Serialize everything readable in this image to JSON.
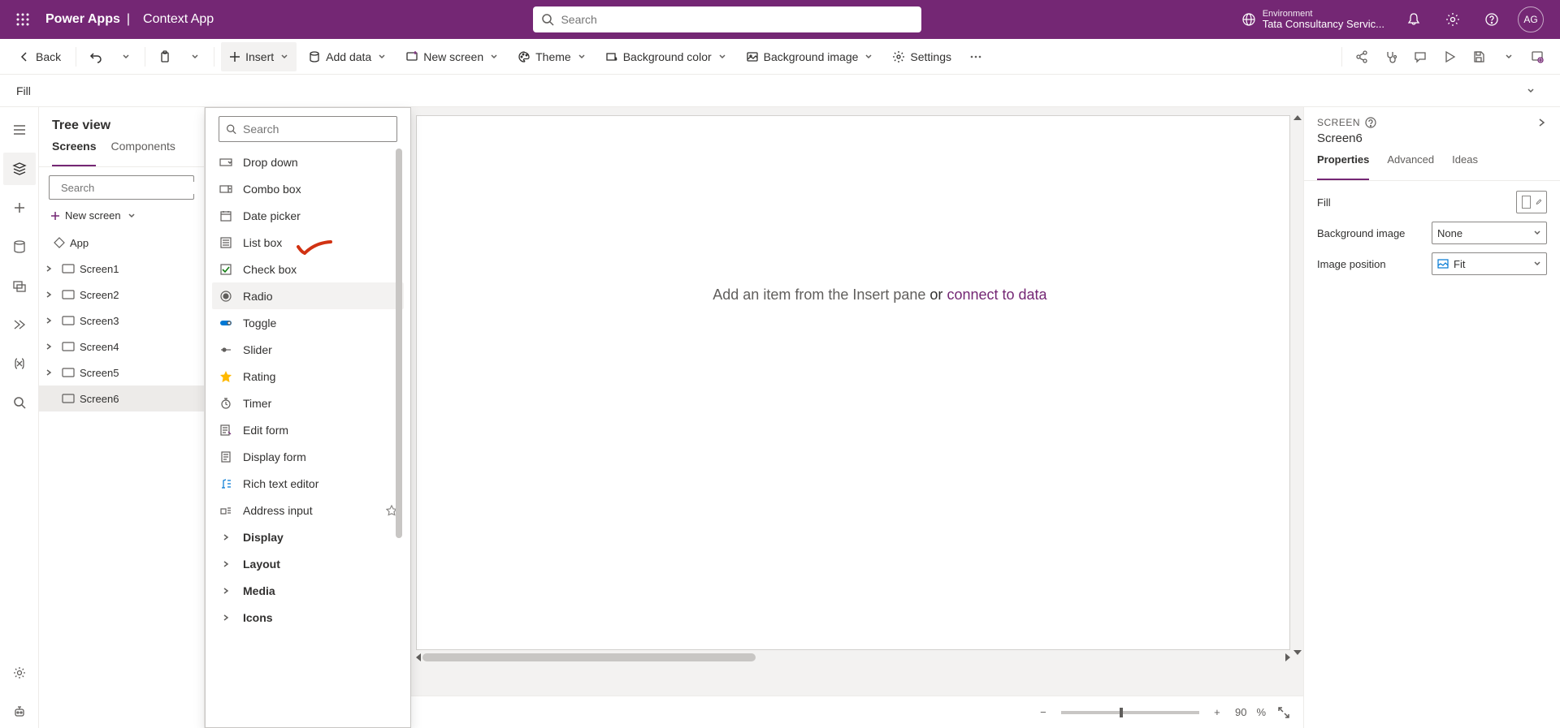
{
  "topbar": {
    "brand": "Power Apps",
    "sep": "|",
    "app_name": "Context App",
    "search_placeholder": "Search",
    "env_label": "Environment",
    "env_name": "Tata Consultancy Servic...",
    "avatar_initials": "AG"
  },
  "cmdbar": {
    "back": "Back",
    "insert": "Insert",
    "add_data": "Add data",
    "new_screen": "New screen",
    "theme": "Theme",
    "bg_color": "Background color",
    "bg_image": "Background image",
    "settings": "Settings"
  },
  "formula": {
    "property": "Fill"
  },
  "tree": {
    "title": "Tree view",
    "tab_screens": "Screens",
    "tab_components": "Components",
    "search_placeholder": "Search",
    "new_screen": "New screen",
    "app_label": "App",
    "screens": [
      "Screen1",
      "Screen2",
      "Screen3",
      "Screen4",
      "Screen5",
      "Screen6"
    ],
    "selected": "Screen6"
  },
  "insert_popup": {
    "search_placeholder": "Search",
    "items": [
      {
        "label": "Drop down",
        "icon": "dropdown"
      },
      {
        "label": "Combo box",
        "icon": "combobox"
      },
      {
        "label": "Date picker",
        "icon": "calendar"
      },
      {
        "label": "List box",
        "icon": "listbox"
      },
      {
        "label": "Check box",
        "icon": "checkbox"
      },
      {
        "label": "Radio",
        "icon": "radio",
        "highlight": true
      },
      {
        "label": "Toggle",
        "icon": "toggle"
      },
      {
        "label": "Slider",
        "icon": "slider"
      },
      {
        "label": "Rating",
        "icon": "star"
      },
      {
        "label": "Timer",
        "icon": "timer"
      },
      {
        "label": "Edit form",
        "icon": "editform"
      },
      {
        "label": "Display form",
        "icon": "displayform"
      },
      {
        "label": "Rich text editor",
        "icon": "richtext"
      },
      {
        "label": "Address input",
        "icon": "address",
        "premium": true
      }
    ],
    "categories": [
      "Display",
      "Layout",
      "Media",
      "Icons"
    ]
  },
  "canvas": {
    "empty_prefix": "Add an item from the Insert pane",
    "empty_or": " or ",
    "empty_link": "connect to data"
  },
  "zoom": {
    "value": "90",
    "pct": "%"
  },
  "props": {
    "section": "SCREEN",
    "name": "Screen6",
    "tab_properties": "Properties",
    "tab_advanced": "Advanced",
    "tab_ideas": "Ideas",
    "fill": "Fill",
    "bg_image": "Background image",
    "bg_image_val": "None",
    "img_pos": "Image position",
    "img_pos_val": "Fit"
  }
}
